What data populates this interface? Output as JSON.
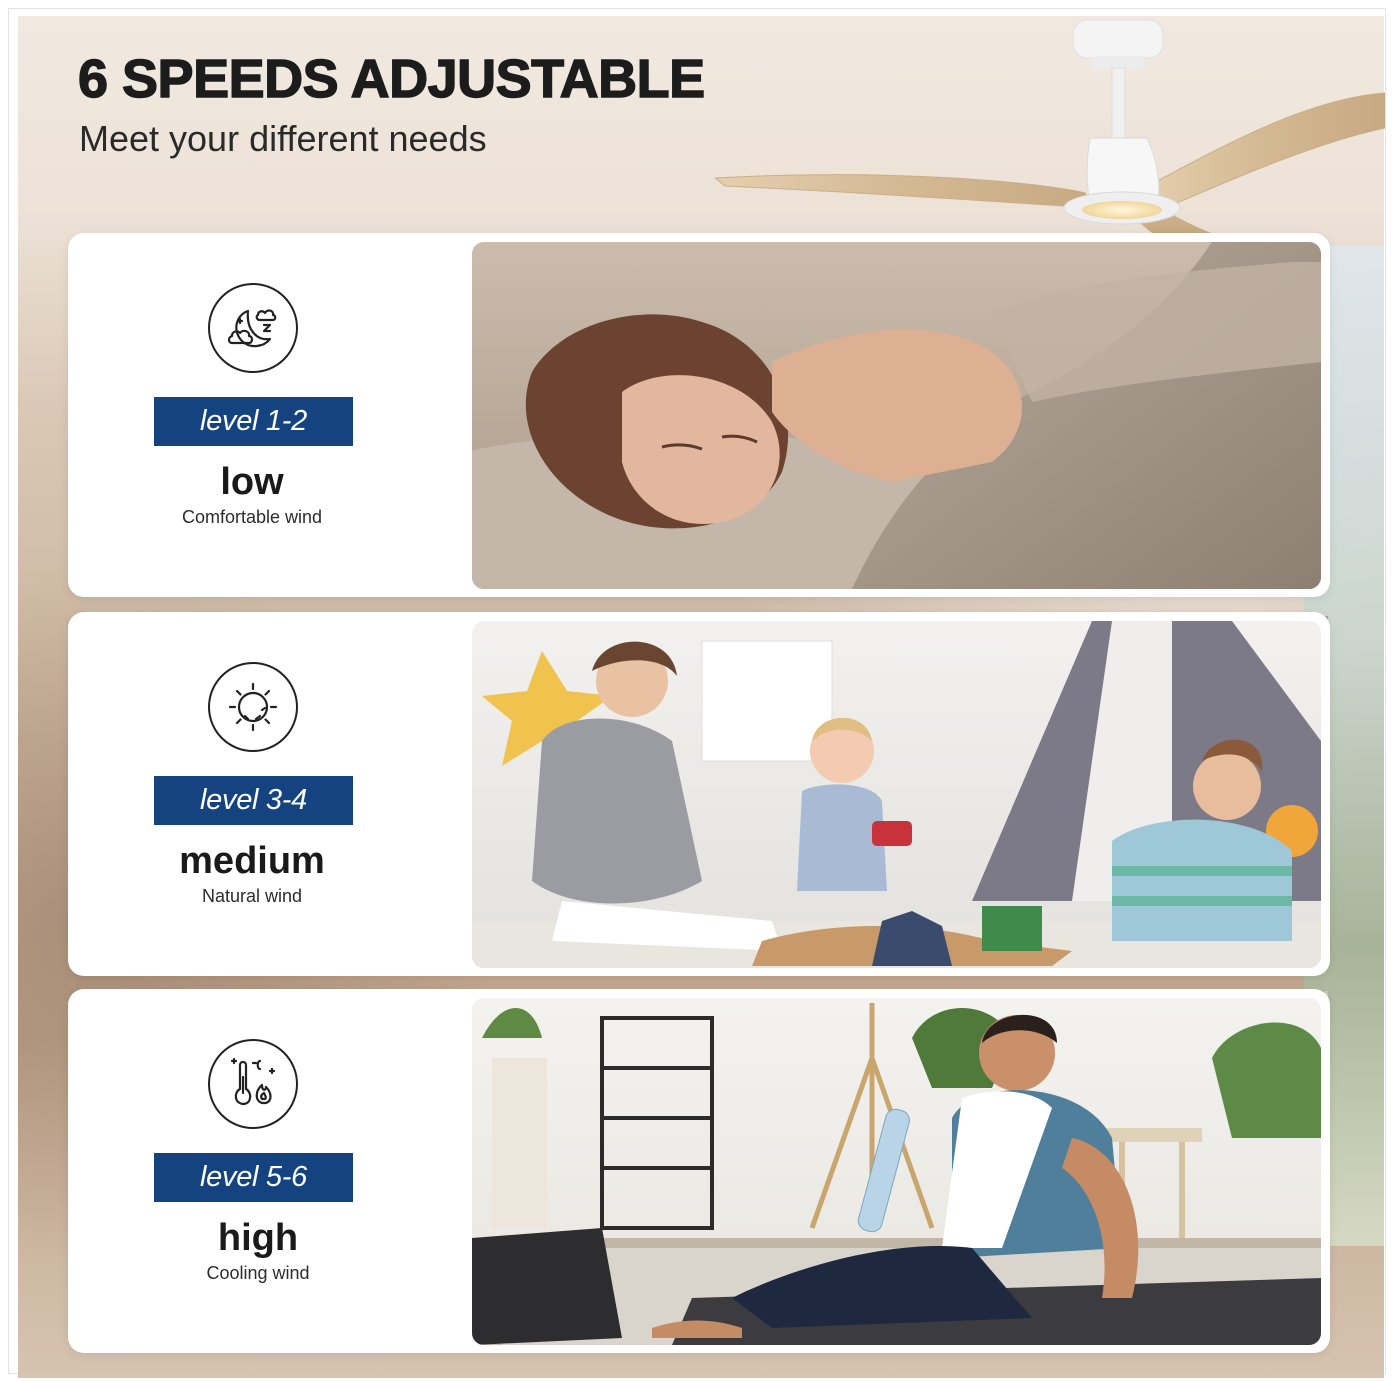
{
  "header": {
    "title": "6 SPEEDS ADJUSTABLE",
    "subtitle": "Meet your different needs"
  },
  "levels": [
    {
      "badge": "level 1-2",
      "name": "low",
      "description": "Comfortable wind",
      "icon": "moon-cloud-sleep-icon",
      "photo": "woman-sleeping-photo"
    },
    {
      "badge": "level 3-4",
      "name": "medium",
      "description": "Natural wind",
      "icon": "sun-icon",
      "photo": "family-playing-photo"
    },
    {
      "badge": "level 5-6",
      "name": "high",
      "description": "Cooling wind",
      "icon": "thermometer-heat-icon",
      "photo": "man-resting-after-workout-photo"
    }
  ],
  "colors": {
    "badge_background": "#15437f",
    "badge_text": "#ffffff",
    "card_background": "#ffffff",
    "headline_text": "#1c1c1c"
  }
}
